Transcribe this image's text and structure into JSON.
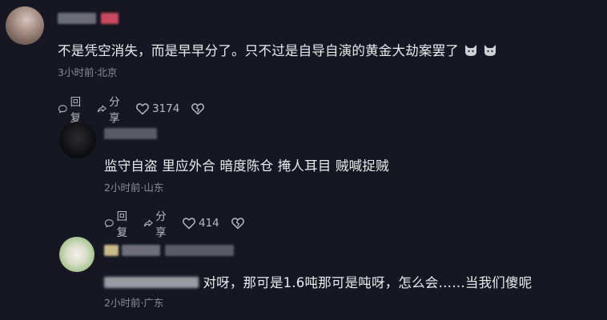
{
  "comments": [
    {
      "text": "不是凭空消失，而是早早分了。只不过是自导自演的黄金大劫案罢了",
      "meta": "3小时前·北京",
      "reply_label": "回复",
      "share_label": "分享",
      "likes": "3174",
      "emojis": [
        "cat-emoji",
        "cat-emoji"
      ]
    },
    {
      "text": "监守自盗 里应外合 暗度陈仓 掩人耳目 贼喊捉贼",
      "meta": "2小时前·山东",
      "reply_label": "回复",
      "share_label": "分享",
      "likes": "414"
    },
    {
      "text": "对呀，那可是1.6吨那可是吨呀，怎么会……当我们傻呢",
      "meta": "2小时前·广东"
    }
  ],
  "colors": {
    "background": "#161722",
    "text": "#ececef",
    "meta": "#8a8b93",
    "action": "#b9bac1"
  }
}
